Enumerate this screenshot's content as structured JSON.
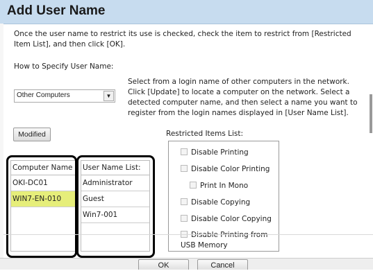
{
  "dialog": {
    "title": "Add User Name",
    "instruction": "Once the user name to restrict its use is checked, check the item to restrict from [Restricted Item List], and then click [OK].",
    "how_label": "How to Specify User Name:",
    "method_select": {
      "value": "Other Computers"
    },
    "description": "Select from a login name of other computers in the network. Click [Update] to locate a computer on the network. Select a detected computer name, and then select a name you want to register from the login names displayed in [User Name List].",
    "modified_label": "Modified",
    "restricted_label": "Restricted Items List:",
    "restricted_items": [
      "Disable Printing",
      "Disable Color Printing",
      "Print In Mono",
      "Disable Copying",
      "Disable Color Copying",
      "Disable Printing from USB Memory"
    ],
    "computer_list": {
      "header": "Computer Name List",
      "items": [
        "OKI-DC01",
        "WIN7-EN-010"
      ],
      "selected_color": "#e6ee7a"
    },
    "user_list": {
      "header": "User Name List:",
      "items": [
        "Administrator",
        "Guest",
        "Win7-001"
      ]
    },
    "ok_label": "OK",
    "cancel_label": "Cancel"
  }
}
